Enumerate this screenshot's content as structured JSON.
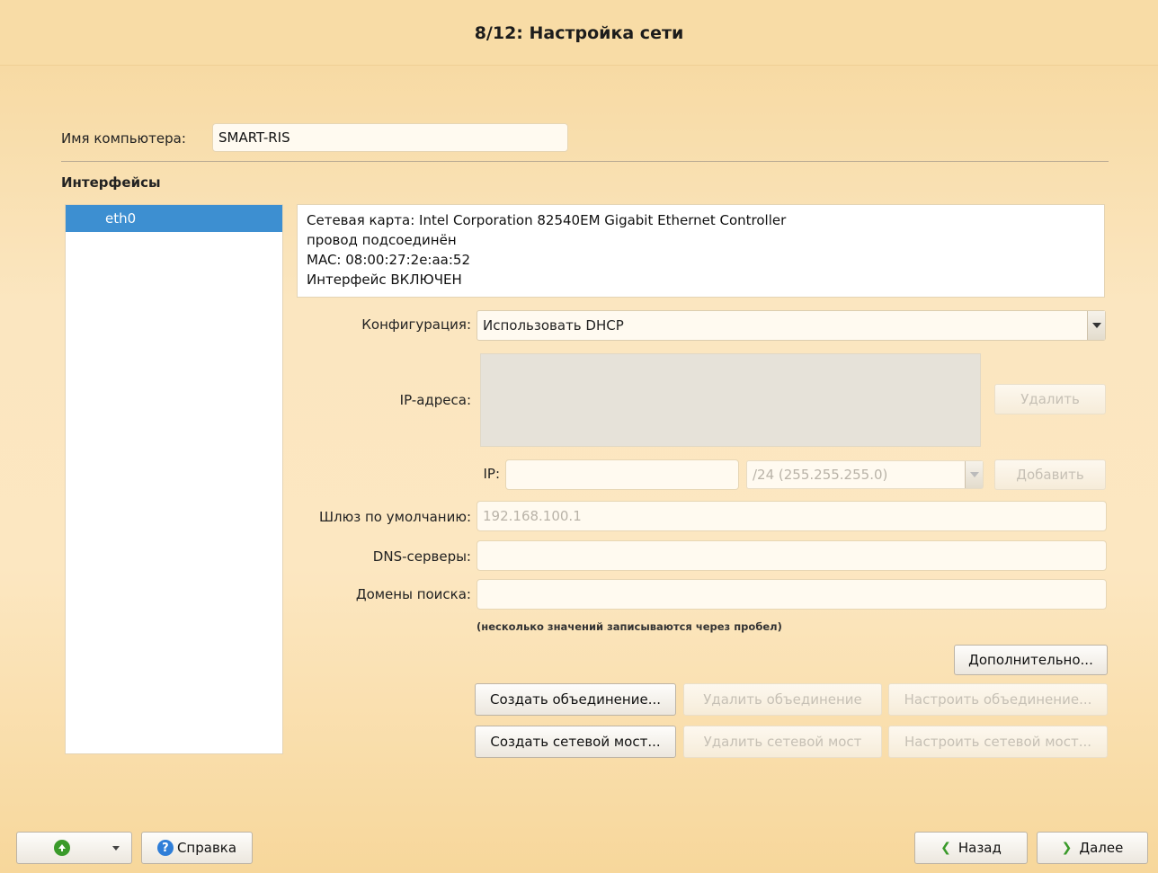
{
  "title": "8/12: Настройка сети",
  "hostname": {
    "label": "Имя компьютера:",
    "value": "SMART-RIS"
  },
  "interfaces": {
    "title": "Интерфейсы",
    "items": [
      {
        "label": "eth0"
      }
    ]
  },
  "info": {
    "line1": "Сетевая карта: Intel Corporation 82540EM Gigabit Ethernet Controller",
    "line2": "провод подсоединён",
    "line3": "MAC: 08:00:27:2e:aa:52",
    "line4": "Интерфейс ВКЛЮЧЕН"
  },
  "config": {
    "label": "Конфигурация:",
    "value": "Использовать DHCP"
  },
  "ip_addresses": {
    "label": "IP-адреса:",
    "delete_label": "Удалить"
  },
  "ip_entry": {
    "label": "IP:",
    "value": "",
    "mask_value": "/24 (255.255.255.0)",
    "add_label": "Добавить"
  },
  "gateway": {
    "label": "Шлюз по умолчанию:",
    "placeholder": "192.168.100.1"
  },
  "dns": {
    "label": "DNS-серверы:",
    "value": ""
  },
  "search_domains": {
    "label": "Домены поиска:",
    "value": ""
  },
  "hint": "(несколько значений записываются через пробел)",
  "buttons": {
    "advanced": "Дополнительно...",
    "create_bond": "Создать объединение...",
    "delete_bond": "Удалить объединение",
    "configure_bond": "Настроить объединение...",
    "create_bridge": "Создать сетевой мост...",
    "delete_bridge": "Удалить сетевой мост",
    "configure_bridge": "Настроить сетевой мост..."
  },
  "footer": {
    "help_label": "Справка",
    "back_label": "Назад",
    "next_label": "Далее"
  },
  "icons": {
    "up": "up-arrow-icon",
    "dropdown": "chevron-down-icon",
    "help": "help-icon",
    "back": "chevron-left-icon",
    "next": "chevron-right-icon"
  },
  "colors": {
    "selection": "#3d8fd1",
    "help_icon": "#2f7ed8",
    "nav_arrow": "#3a9a2a"
  }
}
